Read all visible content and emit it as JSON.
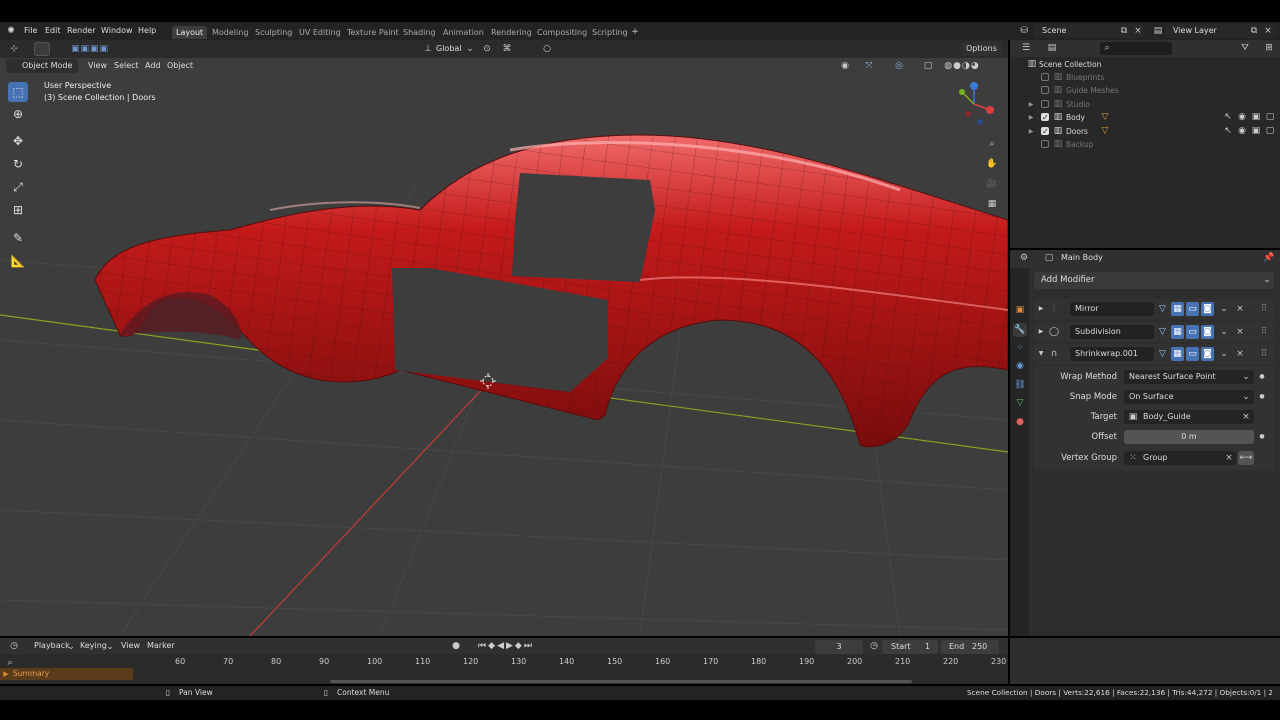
{
  "menu": {
    "file": "File",
    "edit": "Edit",
    "render": "Render",
    "window": "Window",
    "help": "Help"
  },
  "workspaces": [
    "Layout",
    "Modeling",
    "Sculpting",
    "UV Editing",
    "Texture Paint",
    "Shading",
    "Animation",
    "Rendering",
    "Compositing",
    "Scripting"
  ],
  "scene": {
    "name": "Scene",
    "view_layer": "View Layer"
  },
  "toolbar": {
    "transform_orientation": "Global",
    "options": "Options"
  },
  "viewport": {
    "mode": "Object Mode",
    "view": "View",
    "select": "Select",
    "add": "Add",
    "object": "Object",
    "perspective": "User Perspective",
    "collection_info": "(3) Scene Collection | Doors"
  },
  "outliner": {
    "root": "Scene Collection",
    "items": [
      {
        "label": "Blueprints",
        "checked": false
      },
      {
        "label": "Guide Meshes",
        "checked": false
      },
      {
        "label": "Studio",
        "checked": false
      },
      {
        "label": "Body",
        "checked": true
      },
      {
        "label": "Doors",
        "checked": true
      },
      {
        "label": "Backup",
        "checked": false
      }
    ]
  },
  "properties": {
    "object_name": "Main Body",
    "add_modifier": "Add Modifier",
    "modifiers": [
      {
        "name": "Mirror"
      },
      {
        "name": "Subdivision"
      },
      {
        "name": "Shrinkwrap.001"
      }
    ],
    "wrap_method": {
      "label": "Wrap Method",
      "value": "Nearest Surface Point"
    },
    "snap_mode": {
      "label": "Snap Mode",
      "value": "On Surface"
    },
    "target": {
      "label": "Target",
      "value": "Body_Guide"
    },
    "offset": {
      "label": "Offset",
      "value": "0 m"
    },
    "vertex_group": {
      "label": "Vertex Group",
      "value": "Group"
    }
  },
  "timeline": {
    "playback": "Playback",
    "keying": "Keying",
    "view": "View",
    "marker": "Marker",
    "current_frame": "3",
    "start_label": "Start",
    "start": "1",
    "end_label": "End",
    "end": "250",
    "ticks": [
      "60",
      "70",
      "80",
      "90",
      "100",
      "110",
      "120",
      "130",
      "140",
      "150",
      "160",
      "170",
      "180",
      "190",
      "200",
      "210",
      "220",
      "230"
    ],
    "summary": "Summary"
  },
  "statusbar": {
    "pan_view": "Pan View",
    "context_menu": "Context Menu",
    "stats": "Scene Collection | Doors | Verts:22,616 | Faces:22,136 | Tris:44,272 | Objects:0/1 | 2.90.0"
  },
  "colors": {
    "accent": "#4772b3",
    "car_body": "#c41a1a",
    "x_axis": "#c43a3a",
    "y_axis": "#8aa020"
  }
}
